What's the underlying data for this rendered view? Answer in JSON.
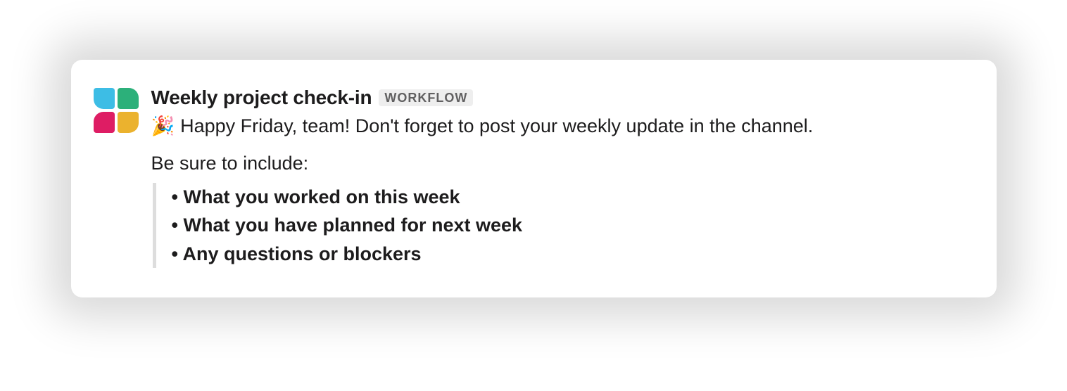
{
  "message": {
    "title": "Weekly project check-in",
    "badge": "WORKFLOW",
    "emoji": "🎉",
    "greeting": "Happy Friday, team! Don't forget to post your weekly update in the channel.",
    "subhead": "Be sure to include:",
    "bullets": [
      "What you worked on this week",
      "What you have planned for next week",
      "Any questions or blockers"
    ]
  }
}
